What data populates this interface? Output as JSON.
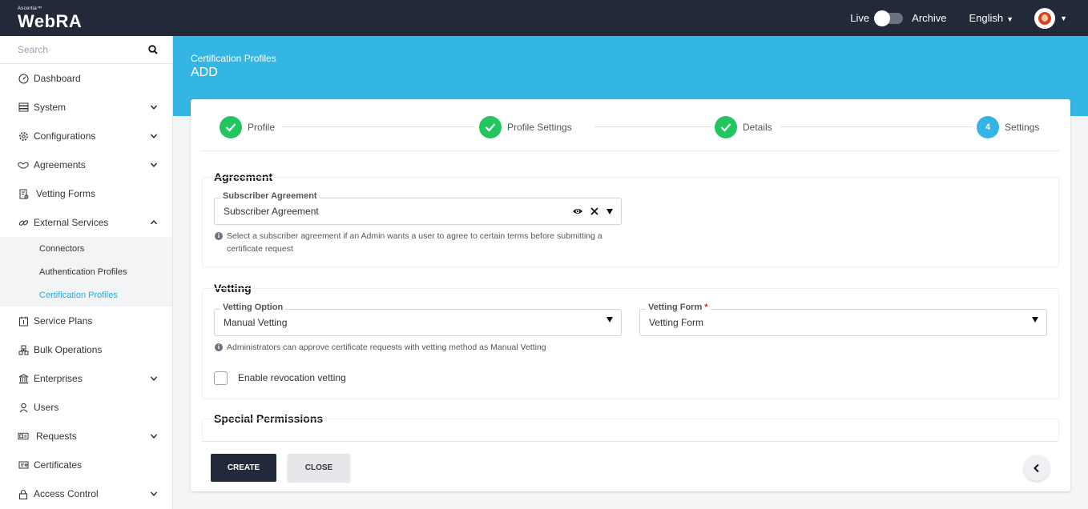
{
  "brand": {
    "small": "Ascertia™",
    "main": "WebRA"
  },
  "topbar": {
    "live_label": "Live",
    "archive_label": "Archive",
    "language": "English"
  },
  "search": {
    "placeholder": "Search"
  },
  "sidebar": {
    "items": [
      {
        "label": "Dashboard",
        "icon": "dashboard-icon"
      },
      {
        "label": "System",
        "icon": "system-icon"
      },
      {
        "label": "Configurations",
        "icon": "gear-icon"
      },
      {
        "label": "Agreements",
        "icon": "handshake-icon"
      },
      {
        "label": "Vetting Forms",
        "icon": "form-icon"
      },
      {
        "label": "External Services",
        "icon": "link-icon"
      }
    ],
    "sub_items": [
      {
        "label": "Connectors"
      },
      {
        "label": "Authentication Profiles"
      },
      {
        "label": "Certification Profiles"
      }
    ],
    "items_after": [
      {
        "label": "Service Plans",
        "icon": "service-plans-icon"
      },
      {
        "label": "Bulk Operations",
        "icon": "bulk-icon"
      },
      {
        "label": "Enterprises",
        "icon": "bank-icon"
      },
      {
        "label": "Users",
        "icon": "user-icon"
      },
      {
        "label": "Requests",
        "icon": "requests-icon"
      },
      {
        "label": "Certificates",
        "icon": "certificate-icon"
      },
      {
        "label": "Access Control",
        "icon": "lock-icon"
      }
    ]
  },
  "hero": {
    "subtitle": "Certification Profiles",
    "title": "ADD"
  },
  "stepper": {
    "steps": [
      {
        "label": "Profile",
        "state": "done"
      },
      {
        "label": "Profile Settings",
        "state": "done"
      },
      {
        "label": "Details",
        "state": "done"
      },
      {
        "label": "Settings",
        "state": "current",
        "number": "4"
      }
    ]
  },
  "agreement": {
    "title": "Agreement",
    "field_label": "Subscriber Agreement",
    "field_value": "Subscriber Agreement",
    "hint": "Select a subscriber agreement if an Admin wants a user to agree to certain terms before submitting a certificate request"
  },
  "vetting": {
    "title": "Vetting",
    "option_label": "Vetting Option",
    "option_value": "Manual Vetting",
    "form_label": "Vetting Form",
    "form_required": "*",
    "form_value": "Vetting Form",
    "hint": "Administrators can approve certificate requests with vetting method as Manual Vetting",
    "revocation_label": "Enable revocation vetting"
  },
  "permissions": {
    "title": "Special Permissions"
  },
  "footer": {
    "create_label": "CREATE",
    "close_label": "CLOSE"
  },
  "colors": {
    "topbar": "#222a3a",
    "accent": "#33b5e5",
    "success": "#22c55e",
    "active_link": "#29a8e0"
  }
}
